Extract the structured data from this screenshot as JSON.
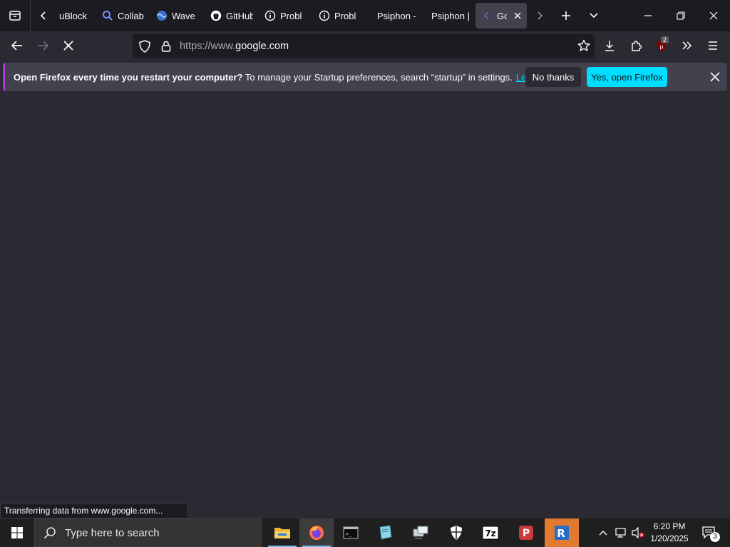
{
  "tabs": [
    {
      "title": "uBlock",
      "icon": "ublock-icon"
    },
    {
      "title": "Collab",
      "icon": "search-magnifier-icon"
    },
    {
      "title": "Wave",
      "icon": "wave-globe-icon"
    },
    {
      "title": "GitHub",
      "icon": "github-icon"
    },
    {
      "title": "Probl",
      "icon": "info-circle-icon"
    },
    {
      "title": "Probl",
      "icon": "info-circle-icon"
    },
    {
      "title": "Psiphon -",
      "icon": ""
    },
    {
      "title": "Psiphon |",
      "icon": ""
    },
    {
      "title": "Go",
      "icon": "loading-icon"
    }
  ],
  "address": {
    "prefix": "https://www.",
    "host": "google.com"
  },
  "notification": {
    "bold": "Open Firefox every time you restart your computer?",
    "text": "To manage your Startup preferences, search “startup” in settings.",
    "link": "Learn more",
    "secondary": "No thanks",
    "primary": "Yes, open Firefox"
  },
  "status_text": "Transferring data from www.google.com...",
  "ublock_badge": "2",
  "taskbar": {
    "search_placeholder": "Type here to search",
    "time": "6:20 PM",
    "date": "1/20/2025",
    "notification_count": "3"
  },
  "colors": {
    "accent": "#00ddff",
    "bg": "#2b2a33",
    "toolbar": "#1c1b22"
  }
}
